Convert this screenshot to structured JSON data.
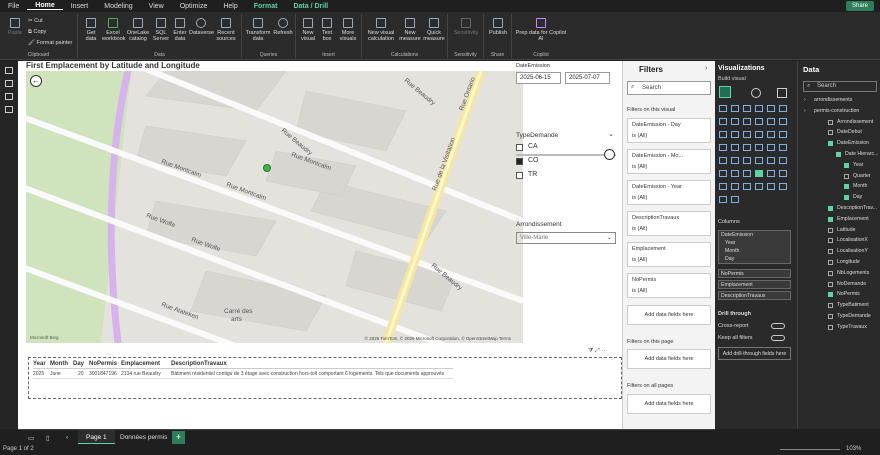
{
  "menu": [
    "File",
    "Home",
    "Insert",
    "Modeling",
    "View",
    "Optimize",
    "Help",
    "Format",
    "Data / Drill"
  ],
  "share_label": "Share",
  "ribbon": {
    "clipboard": {
      "paste": "Paste",
      "cut": "Cut",
      "copy": "Copy",
      "format_painter": "Format painter",
      "group": "Clipboard"
    },
    "data": {
      "get_data": "Get data",
      "excel": "Excel workbook",
      "onelake": "OneLake catalog",
      "sql": "SQL Server",
      "enter": "Enter data",
      "dataverse": "Dataverse",
      "recent": "Recent sources",
      "group": "Data"
    },
    "queries": {
      "transform": "Transform data",
      "refresh": "Refresh",
      "group": "Queries"
    },
    "insert": {
      "new_visual": "New visual",
      "text_box": "Text box",
      "more_visuals": "More visuals",
      "group": "Insert"
    },
    "calculations": {
      "new_calc": "New visual calculation",
      "new_measure": "New measure",
      "quick_measure": "Quick measure",
      "group": "Calculations"
    },
    "sensitivity": {
      "label": "Sensitivity",
      "group": "Sensitivity"
    },
    "share": {
      "publish": "Publish",
      "group": "Share"
    },
    "copilot": {
      "prep": "Prep data for Copilot AI",
      "group": "Copilot"
    }
  },
  "map": {
    "title": "First Emplacement by Latitude and Longitude",
    "credit": "© 2025 TomTom, © 2025 Microsoft Corporation, © OpenStreetMap  Terms",
    "bing": "Microsoft Bing",
    "streets": [
      "Rue Ontario",
      "Rue de la Visitation",
      "Rue Montcalm",
      "Rue Montcalm",
      "Rue Beaudry",
      "Rue Beaudry",
      "Rue Wolfe",
      "Rue Wolfe",
      "Rue Atateken",
      "Rue Beaudry",
      "Rue Montcalm"
    ],
    "place": [
      "Carré des",
      "arts"
    ]
  },
  "date_slicer": {
    "label": "DateEmission",
    "start": "2025-06-15",
    "end": "2025-07-07"
  },
  "type_slicer": {
    "label": "TypeDemande",
    "options": [
      {
        "label": "CA",
        "checked": false
      },
      {
        "label": "CO",
        "checked": true
      },
      {
        "label": "TR",
        "checked": false
      }
    ]
  },
  "arr_slicer": {
    "label": "Arrondissement",
    "value": "Ville-Marie"
  },
  "table": {
    "headers": [
      "Year",
      "Month",
      "Day",
      "NoPermis",
      "Emplacement",
      "DescriptionTravaux"
    ],
    "row": [
      "2025",
      "June",
      "20",
      "3001847196",
      "2134 rue Beaudry",
      "Bâtiment résidentiel contigu de 3 étage avec construction hors-toit comportant 6 logements. Tels que documents approuvés"
    ]
  },
  "tabs": {
    "page1": "Page 1",
    "page2": "Données permis"
  },
  "status": {
    "page": "Page 1 of 2",
    "zoom": "103%"
  },
  "filters": {
    "title": "Filters",
    "search": "Search",
    "on_visual": "Filters on this visual",
    "cards": [
      {
        "title": "DateEmission - Day",
        "value": "is (All)"
      },
      {
        "title": "DateEmission - Mo...",
        "value": "is (All)"
      },
      {
        "title": "DateEmission - Year",
        "value": "is (All)"
      },
      {
        "title": "DescriptionTravaux",
        "value": "is (All)"
      },
      {
        "title": "Emplacement",
        "value": "is (All)"
      },
      {
        "title": "NoPermis",
        "value": "is (All)"
      }
    ],
    "add": "Add data fields here",
    "on_page": "Filters on this page",
    "on_all": "Filters on all pages"
  },
  "viz": {
    "title": "Visualizations",
    "build": "Build visual",
    "columns": "Columns",
    "date_well": {
      "head": "DateEmission",
      "items": [
        "Year",
        "Month",
        "Day"
      ]
    },
    "wells": [
      "NoPermis",
      "Emplacement",
      "DescriptionTravaux"
    ],
    "drill": "Drill through",
    "cross": "Cross-report",
    "keep": "Keep all filters",
    "add_drill": "Add drill-through fields here"
  },
  "data_pane": {
    "title": "Data",
    "search": "Search",
    "items": [
      {
        "label": "arrondissements",
        "indent": 0,
        "cb": false,
        "show_cb": false
      },
      {
        "label": "permis-construction",
        "indent": 0,
        "cb": false,
        "show_cb": false
      },
      {
        "label": "Arrondissement",
        "indent": 1,
        "cb": false,
        "show_cb": true
      },
      {
        "label": "DateDebut",
        "indent": 1,
        "cb": false,
        "show_cb": true
      },
      {
        "label": "DateEmission",
        "indent": 1,
        "cb": true,
        "show_cb": true
      },
      {
        "label": "Date Hierarc...",
        "indent": 2,
        "cb": true,
        "show_cb": true
      },
      {
        "label": "Year",
        "indent": 3,
        "cb": true,
        "show_cb": true
      },
      {
        "label": "Quarter",
        "indent": 3,
        "cb": false,
        "show_cb": true
      },
      {
        "label": "Month",
        "indent": 3,
        "cb": true,
        "show_cb": true
      },
      {
        "label": "Day",
        "indent": 3,
        "cb": true,
        "show_cb": true
      },
      {
        "label": "DescriptionTrav...",
        "indent": 1,
        "cb": true,
        "show_cb": true
      },
      {
        "label": "Emplacement",
        "indent": 1,
        "cb": true,
        "show_cb": true
      },
      {
        "label": "Latitude",
        "indent": 1,
        "cb": false,
        "show_cb": true
      },
      {
        "label": "LocalisationX",
        "indent": 1,
        "cb": false,
        "show_cb": true
      },
      {
        "label": "LocalisationY",
        "indent": 1,
        "cb": false,
        "show_cb": true
      },
      {
        "label": "Longitude",
        "indent": 1,
        "cb": false,
        "show_cb": true
      },
      {
        "label": "NbLogements",
        "indent": 1,
        "cb": false,
        "show_cb": true
      },
      {
        "label": "NoDemande",
        "indent": 1,
        "cb": false,
        "show_cb": true
      },
      {
        "label": "NoPermis",
        "indent": 1,
        "cb": true,
        "show_cb": true
      },
      {
        "label": "TypeBatiment",
        "indent": 1,
        "cb": false,
        "show_cb": true
      },
      {
        "label": "TypeDemande",
        "indent": 1,
        "cb": false,
        "show_cb": true
      },
      {
        "label": "TypeTravaux",
        "indent": 1,
        "cb": false,
        "show_cb": true
      }
    ]
  }
}
